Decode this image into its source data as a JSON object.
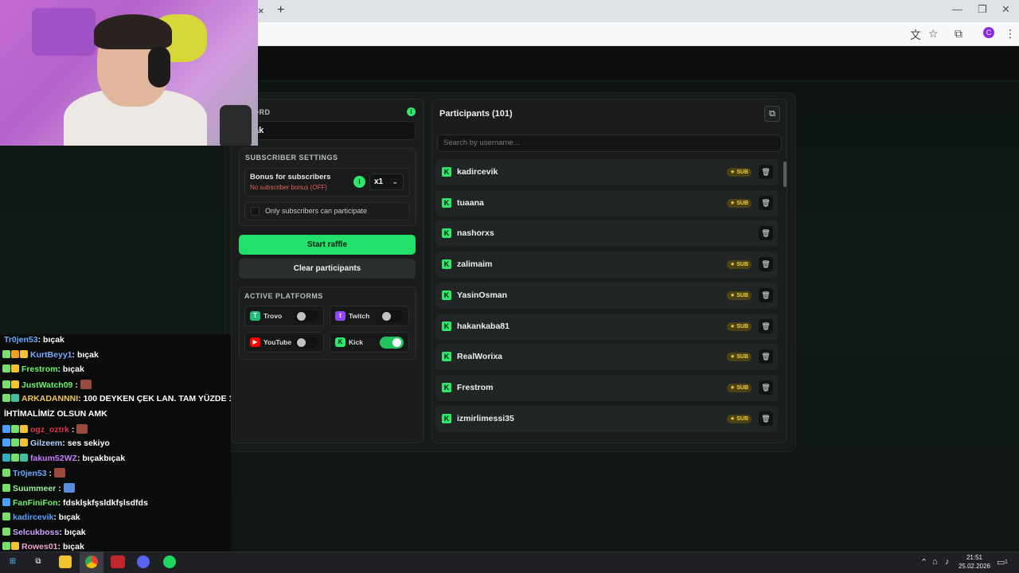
{
  "browser": {
    "tab_close": "×",
    "tab_new": "+",
    "minimize": "—",
    "restore": "❐",
    "close": "✕",
    "profile_initial": "C"
  },
  "raffle": {
    "keyword_label": "WORD",
    "keyword_value": "ak",
    "subscriber_settings_title": "SUBSCRIBER SETTINGS",
    "bonus_title": "Bonus for subscribers",
    "bonus_subtitle": "No subscriber bonus (OFF)",
    "bonus_multiplier": "x1",
    "only_subscribers_label": "Only subscribers can participate",
    "start_button": "Start raffle",
    "clear_button": "Clear participants",
    "active_platforms_title": "ACTIVE PLATFORMS",
    "platforms": [
      {
        "name": "Trovo",
        "icon": "trovo-icon",
        "color": "#1fbf77",
        "enabled": false
      },
      {
        "name": "Twitch",
        "icon": "twitch-icon",
        "color": "#9146ff",
        "enabled": false
      },
      {
        "name": "YouTube",
        "icon": "youtube-icon",
        "color": "#ff0000",
        "enabled": false
      },
      {
        "name": "Kick",
        "icon": "kick-icon",
        "color": "#2ee86b",
        "enabled": true
      }
    ]
  },
  "participants": {
    "title": "Participants (101)",
    "search_placeholder": "Search by username...",
    "sub_badge": "SUB",
    "rows": [
      {
        "name": "kadircevik",
        "sub": true
      },
      {
        "name": "tuaana",
        "sub": true
      },
      {
        "name": "nashorxs",
        "sub": false
      },
      {
        "name": "zalimaim",
        "sub": true
      },
      {
        "name": "YasinOsman",
        "sub": true
      },
      {
        "name": "hakankaba81",
        "sub": true
      },
      {
        "name": "RealWorixa",
        "sub": true
      },
      {
        "name": "Frestrom",
        "sub": true
      },
      {
        "name": "izmirlimessi35",
        "sub": true
      }
    ]
  },
  "chat": {
    "lines": [
      {
        "user": "Tr0jen53",
        "color": "#6aa8ff",
        "msg": ": bıçak",
        "badges": []
      },
      {
        "user": "KurtBeyy1",
        "color": "#7fa8ff",
        "msg": ": bıçak",
        "badges": [
          "z",
          "o",
          "c"
        ]
      },
      {
        "user": "Frestrom",
        "color": "#6df06d",
        "msg": ": bıçak",
        "badges": [
          "z",
          "c"
        ]
      },
      {
        "user": "JustWatch09",
        "color": "#6df06d",
        "msg": " : ",
        "emote": "red",
        "badges": [
          "z",
          "c"
        ]
      },
      {
        "user": "ARKADANNNI",
        "color": "#f0c45a",
        "msg": ": 100 DEYKEN ÇEK LAN. TAM YÜZDE 1",
        "badges": [
          "z",
          "g"
        ]
      },
      {
        "user": "",
        "color": "#ffffff",
        "msg": "İHTİMALİMİZ OLSUN AMK",
        "badges": []
      },
      {
        "user": "ogz_oztrk",
        "color": "#e0304a",
        "msg": " : ",
        "emote": "red",
        "badges": [
          "b",
          "z",
          "c"
        ]
      },
      {
        "user": "Gilzeem",
        "color": "#b0d0ff",
        "msg": ": ses sekiyo",
        "badges": [
          "b",
          "z",
          "c"
        ]
      },
      {
        "user": "fakum52WZ",
        "color": "#c77dff",
        "msg": ": bıçakbıçak",
        "badges": [
          "s",
          "z",
          "g"
        ]
      },
      {
        "user": "Tr0jen53",
        "color": "#6aa8ff",
        "msg": " : ",
        "emote": "red",
        "badges": [
          "z"
        ]
      },
      {
        "user": "Suummeer",
        "color": "#9df09d",
        "msg": " : ",
        "emote": "blue",
        "badges": [
          "z"
        ]
      },
      {
        "user": "FanFiniFon",
        "color": "#6df06d",
        "msg": ": fdsklşkfşsldkfşlsdfds",
        "badges": [
          "b"
        ]
      },
      {
        "user": "kadircevik",
        "color": "#5aa0ff",
        "msg": ": bıçak",
        "badges": [
          "z"
        ]
      },
      {
        "user": "Selcukboss",
        "color": "#d0a0ff",
        "msg": ": bıçak",
        "badges": [
          "z"
        ]
      },
      {
        "user": "Rowes01",
        "color": "#f0a0d0",
        "msg": ": bıçak",
        "badges": [
          "z",
          "c"
        ]
      }
    ]
  },
  "taskbar": {
    "clock_time": "21:51",
    "clock_date": "25.02.2026",
    "notification_count": "1"
  }
}
